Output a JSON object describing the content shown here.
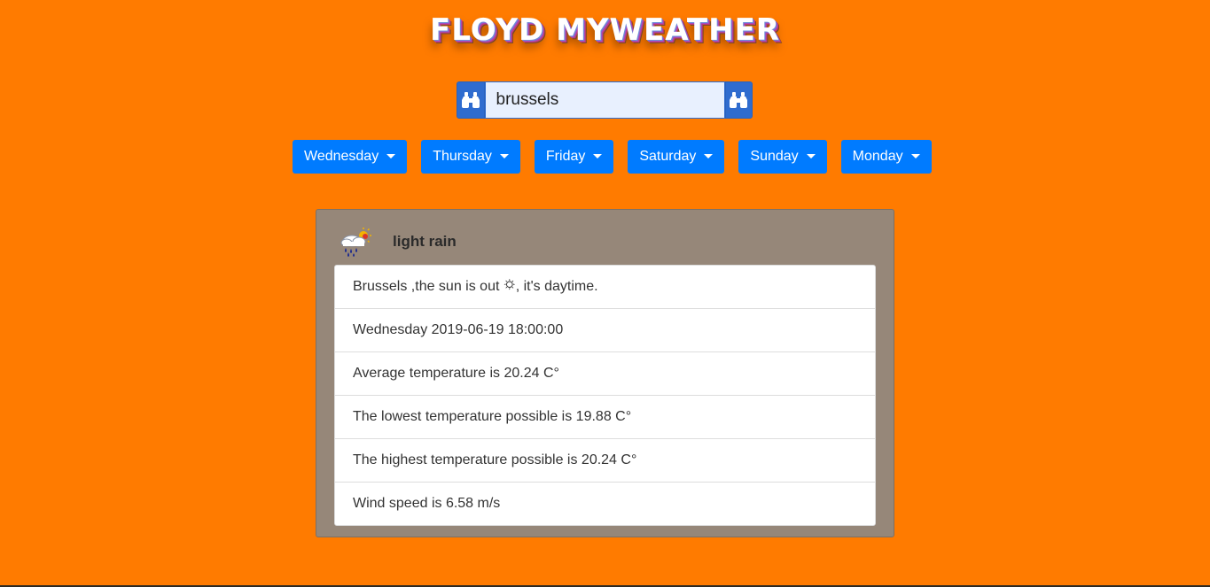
{
  "app": {
    "title": "FLOYD MYWEATHER"
  },
  "search": {
    "value": "brussels",
    "left_icon": "binoculars-icon",
    "right_icon": "binoculars-icon"
  },
  "days": [
    {
      "label": "Wednesday"
    },
    {
      "label": "Thursday"
    },
    {
      "label": "Friday"
    },
    {
      "label": "Saturday"
    },
    {
      "label": "Sunday"
    },
    {
      "label": "Monday"
    }
  ],
  "weather": {
    "icon": "rain-cloud-sun-icon",
    "description": "light rain",
    "sun_text_before": "Brussels ,the sun is out ",
    "sun_glyph": "🌣",
    "sun_text_after": ", it's daytime.",
    "datetime": "Wednesday 2019-06-19 18:00:00",
    "average": "Average temperature is 20.24 C°",
    "lowest": "The lowest temperature possible is 19.88 C°",
    "highest": "The highest temperature possible is 20.24 C°",
    "wind": "Wind speed is 6.58 m/s"
  },
  "colors": {
    "background": "#ff7b00",
    "day_button": "#007bff",
    "search_button": "#2f6ccf",
    "card": "#968779"
  }
}
